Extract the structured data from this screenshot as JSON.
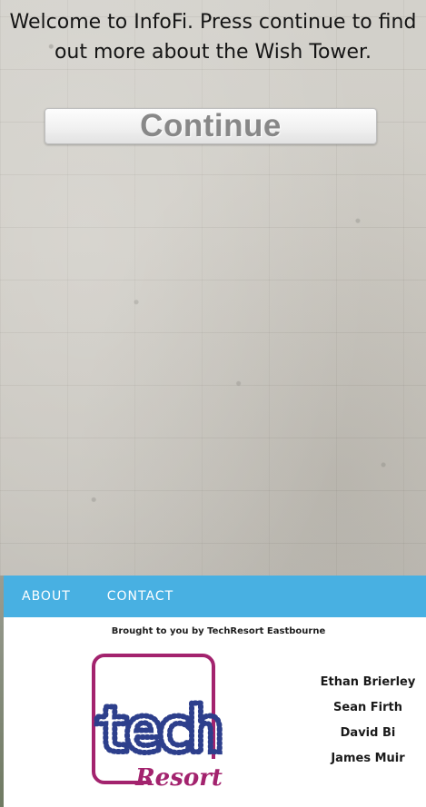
{
  "welcome_text": "Welcome to InfoFi. Press continue to find out more about the Wish Tower.",
  "continue_button": {
    "label": "Continue"
  },
  "nav": {
    "items": [
      {
        "label": "ABOUT"
      },
      {
        "label": "CONTACT"
      }
    ]
  },
  "footer": {
    "brought_by": "Brought to you by TechResort Eastbourne",
    "logo": {
      "word_top": "tech",
      "word_bottom": "Resort"
    },
    "members": [
      "Ethan Brierley",
      "Sean Firth",
      "David Bi",
      "James Muir"
    ]
  },
  "colors": {
    "nav_background": "#48b0e2",
    "logo_frame": "#a3236e",
    "logo_tech": "#2d3f8c",
    "logo_resort": "#a3236e"
  },
  "icons": {
    "logo": "techresort-logo"
  }
}
